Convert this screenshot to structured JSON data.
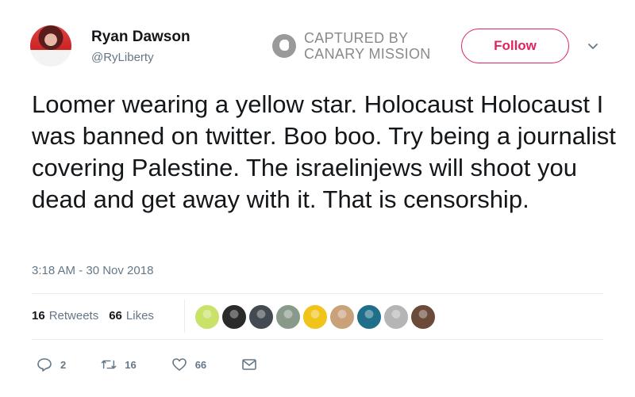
{
  "user": {
    "display_name": "Ryan Dawson",
    "handle": "@RyLiberty",
    "avatar_icon": "user-avatar"
  },
  "stamp": {
    "line1": "CAPTURED BY",
    "line2": "CANARY MISSION",
    "icon": "canary-bird-icon"
  },
  "follow_label": "Follow",
  "tweet": {
    "text": "Loomer wearing a yellow star. Holocaust Holocaust I was banned on twitter. Boo boo. Try being a journalist covering Palestine. The israelinjews will shoot you dead and get away with it. That is censorship.",
    "timestamp": "3:18 AM - 30 Nov 2018"
  },
  "stats": {
    "retweets_count": "16",
    "retweets_label": "Retweets",
    "likes_count": "66",
    "likes_label": "Likes"
  },
  "likers": [
    {
      "color": "#c8e26a"
    },
    {
      "color": "#2a2a2a"
    },
    {
      "color": "#444a52"
    },
    {
      "color": "#8a9a8a"
    },
    {
      "color": "#f0c419"
    },
    {
      "color": "#c9a27a"
    },
    {
      "color": "#1f6f8b"
    },
    {
      "color": "#b5b5b5"
    },
    {
      "color": "#6b4a3a"
    }
  ],
  "actions": {
    "replies": "2",
    "retweets": "16",
    "likes": "66"
  },
  "colors": {
    "follow_accent": "#e0245e",
    "muted": "#657786",
    "stamp_gray": "#8a8a8a"
  }
}
